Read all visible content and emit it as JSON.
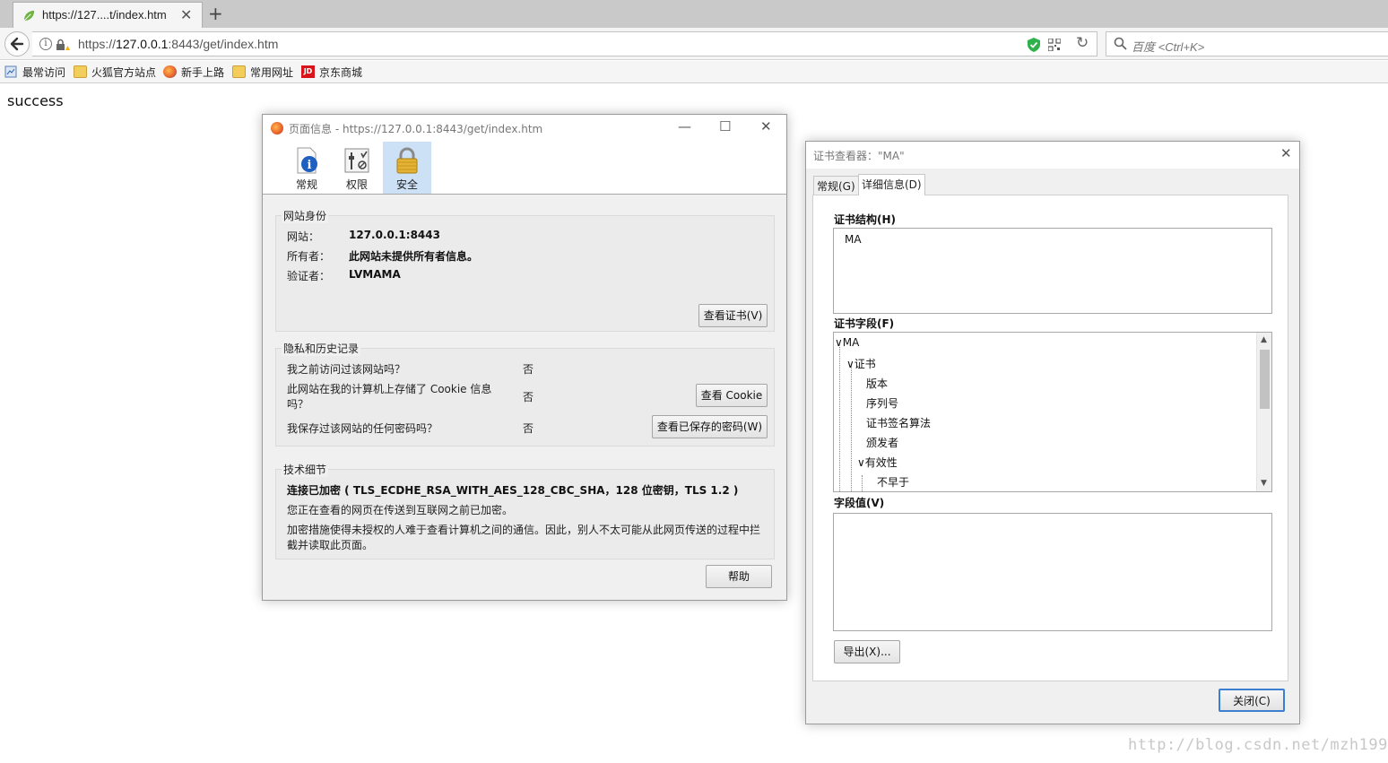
{
  "browser": {
    "tab_title": "https://127....t/index.htm",
    "url_prefix": "https://",
    "url_host": "127.0.0.1",
    "url_rest": ":8443/get/index.htm",
    "search_placeholder": "百度 <Ctrl+K>",
    "bookmarks": [
      "最常访问",
      "火狐官方站点",
      "新手上路",
      "常用网址",
      "京东商城"
    ]
  },
  "page": {
    "content": "success",
    "watermark": "http://blog.csdn.net/mzh1992"
  },
  "page_info": {
    "title": "页面信息 - https://127.0.0.1:8443/get/index.htm",
    "toolbar": [
      "常规",
      "权限",
      "安全"
    ],
    "identity": {
      "title": "网站身份",
      "website_label": "网站：",
      "website_value": "127.0.0.1:8443",
      "owner_label": "所有者：",
      "owner_value": "此网站未提供所有者信息。",
      "verifier_label": "验证者：",
      "verifier_value": "LVMAMA",
      "view_cert_button": "查看证书(V)"
    },
    "privacy": {
      "title": "隐私和历史记录",
      "q1": "我之前访问过该网站吗？",
      "a1": "否",
      "q2_line1": "此网站在我的计算机上存储了 Cookie 信息",
      "q2_line2": "吗？",
      "a2": "否",
      "cookie_button": "查看 Cookie",
      "q3": "我保存过该网站的任何密码吗？",
      "a3": "否",
      "password_button": "查看已保存的密码(W)"
    },
    "technical": {
      "title": "技术细节",
      "connection": "连接已加密 ( TLS_ECDHE_RSA_WITH_AES_128_CBC_SHA，128 位密钥，TLS 1.2 )",
      "line1": "您正在查看的网页在传送到互联网之前已加密。",
      "line2a": "加密措施使得未授权的人难于查看计算机之间的通信。因此，别人不太可能从此网页传送的过程中拦",
      "line2b": "截并读取此页面。"
    },
    "help_button": "帮助"
  },
  "cert_viewer": {
    "title": "证书查看器：\"MA\"",
    "tabs": [
      "常规(G)",
      "详细信息(D)"
    ],
    "hierarchy_label": "证书结构(H)",
    "hierarchy_item": "MA",
    "fields_label": "证书字段(F)",
    "tree": [
      "MA",
      "证书",
      "版本",
      "序列号",
      "证书签名算法",
      "颁发者",
      "有效性",
      "不早于"
    ],
    "value_label": "字段值(V)",
    "export_button": "导出(X)...",
    "close_button": "关闭(C)"
  }
}
